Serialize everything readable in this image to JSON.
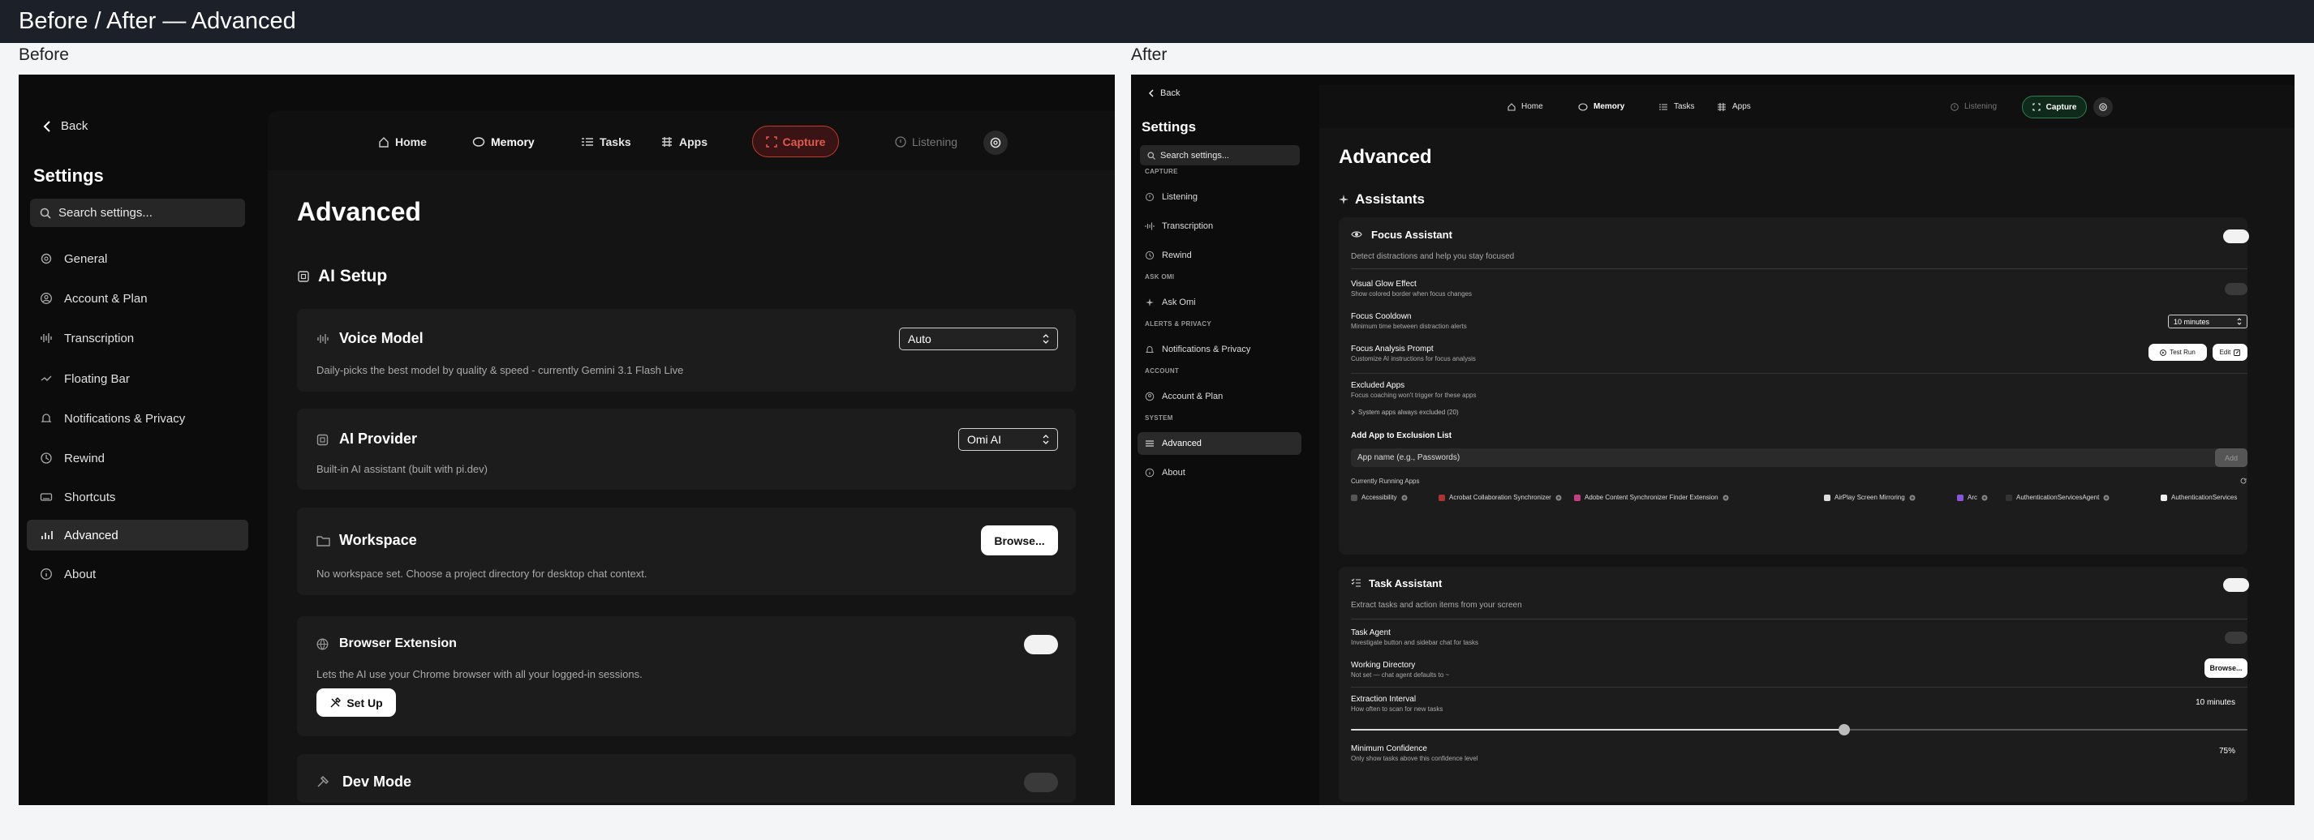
{
  "page_title": "Before / After — Advanced",
  "before": {
    "label": "Before",
    "back": "Back",
    "settings_title": "Settings",
    "search_placeholder": "Search settings...",
    "sidebar": [
      "General",
      "Account & Plan",
      "Transcription",
      "Floating Bar",
      "Notifications & Privacy",
      "Rewind",
      "Shortcuts",
      "Advanced",
      "About"
    ],
    "nav": {
      "home": "Home",
      "memory": "Memory",
      "tasks": "Tasks",
      "apps": "Apps",
      "capture": "Capture",
      "listening": "Listening"
    },
    "heading": "Advanced",
    "section": "AI Setup",
    "voice_model": {
      "title": "Voice Model",
      "desc": "Daily-picks the best model by quality & speed - currently Gemini 3.1 Flash Live",
      "value": "Auto"
    },
    "ai_provider": {
      "title": "AI Provider",
      "desc": "Built-in AI assistant (built with pi.dev)",
      "value": "Omi AI"
    },
    "workspace": {
      "title": "Workspace",
      "desc": "No workspace set. Choose a project directory for desktop chat context.",
      "button": "Browse..."
    },
    "browser_ext": {
      "title": "Browser Extension",
      "desc": "Lets the AI use your Chrome browser with all your logged-in sessions.",
      "button": "Set Up",
      "on": true
    },
    "dev_mode": {
      "title": "Dev Mode",
      "on": false
    }
  },
  "after": {
    "label": "After",
    "back": "Back",
    "settings_title": "Settings",
    "search_placeholder": "Search settings...",
    "groups": [
      {
        "header": "CAPTURE",
        "items": [
          "Listening",
          "Transcription",
          "Rewind"
        ]
      },
      {
        "header": "ASK OMI",
        "items": [
          "Ask Omi"
        ]
      },
      {
        "header": "ALERTS & PRIVACY",
        "items": [
          "Notifications & Privacy"
        ]
      },
      {
        "header": "ACCOUNT",
        "items": [
          "Account & Plan"
        ]
      },
      {
        "header": "SYSTEM",
        "items": [
          "Advanced",
          "About"
        ]
      }
    ],
    "nav": {
      "home": "Home",
      "memory": "Memory",
      "tasks": "Tasks",
      "apps": "Apps",
      "listening": "Listening",
      "capture": "Capture"
    },
    "heading": "Advanced",
    "section": "Assistants",
    "focus": {
      "title": "Focus Assistant",
      "desc": "Detect distractions and help you stay focused",
      "on": true,
      "glow": {
        "title": "Visual Glow Effect",
        "desc": "Show colored border when focus changes",
        "on": false
      },
      "cooldown": {
        "title": "Focus Cooldown",
        "desc": "Minimum time between distraction alerts",
        "value": "10 minutes"
      },
      "prompt": {
        "title": "Focus Analysis Prompt",
        "desc": "Customize AI instructions for focus analysis",
        "test": "Test Run",
        "edit": "Edit"
      },
      "excluded": {
        "title": "Excluded Apps",
        "desc": "Focus coaching won't trigger for these apps",
        "system": "System apps always excluded (20)"
      },
      "add": {
        "title": "Add App to Exclusion List",
        "placeholder": "App name (e.g., Passwords)",
        "button": "Add"
      },
      "running": {
        "title": "Currently Running Apps",
        "apps": [
          "Accessibility",
          "Acrobat Collaboration Synchronizer",
          "Adobe Content Synchronizer Finder Extension",
          "AirPlay Screen Mirroring",
          "Arc",
          "AuthenticationServicesAgent",
          "AuthenticationServices"
        ]
      }
    },
    "task": {
      "title": "Task Assistant",
      "desc": "Extract tasks and action items from your screen",
      "on": true,
      "agent": {
        "title": "Task Agent",
        "desc": "Investigate button and sidebar chat for tasks",
        "on": false
      },
      "dir": {
        "title": "Working Directory",
        "desc": "Not set — chat agent defaults to ~",
        "button": "Browse..."
      },
      "interval": {
        "title": "Extraction Interval",
        "desc": "How often to scan for new tasks",
        "value": "10 minutes",
        "slider_fraction": 0.55
      },
      "confidence": {
        "title": "Minimum Confidence",
        "desc": "Only show tasks above this confidence level",
        "value": "75%"
      }
    }
  }
}
